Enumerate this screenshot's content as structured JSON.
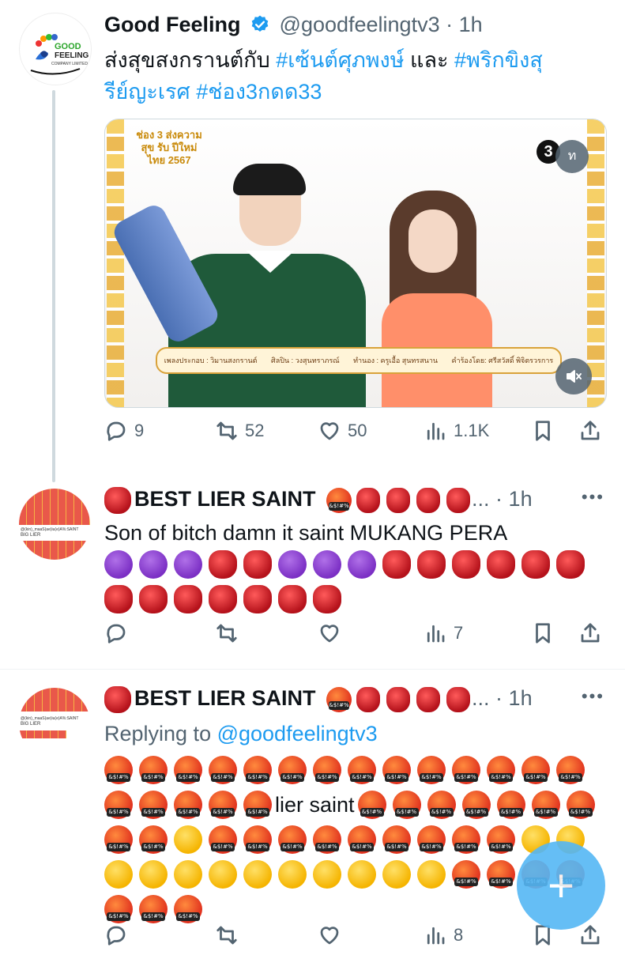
{
  "tweets": [
    {
      "name": "Good Feeling",
      "verified": true,
      "handle": "@goodfeelingtv3",
      "time": "1h",
      "avatar_logo": {
        "line1": "GOOD",
        "line2": "FEELING",
        "line3": "COMPANY LIMITED"
      },
      "text_plain_1": "ส่งสุขสงกรานต์กับ ",
      "hashtag_1": "#เซ้นต์ศุภพงษ์",
      "text_plain_2": " และ ",
      "hashtag_2": "#พริกขิงสุรีย์ญะเรศ",
      "hashtag_3": "#ช่อง3กดด33",
      "media": {
        "banner_top": "ช่อง 3 ส่งความสุข รับ ปีใหม่ไทย 2567",
        "channel_badge": "3",
        "rating_badge": "ท",
        "credits": [
          "เพลงประกอบ : วิมานสงกรานต์",
          "ศิลปิน : วงสุนทราภรณ์",
          "ทำนอง : ครูเอื้อ สุนทรสนาน",
          "คำร้องโดย: ศรีสวัสดิ์ พิจิตรวรการ"
        ]
      },
      "replies": "9",
      "reposts": "52",
      "likes": "50",
      "views": "1.1K"
    },
    {
      "name": "BEST LIER SAINT",
      "handle_truncated": "...",
      "time": "1h",
      "text": "Son of bitch damn it  saint MUKANG PERA",
      "views": "7",
      "avatar_text": {
        "line1": "@(kin)_maaS(ae)iu(e)A%:SAINT",
        "line2": "BIG LIER"
      }
    },
    {
      "name": "BEST LIER SAINT",
      "time": "1h",
      "replying_prefix": "Replying to ",
      "replying_handle": "@goodfeelingtv3",
      "inline_text": "lier saint",
      "views": "8",
      "avatar_text": {
        "line1": "@(kin)_maaS(ae)iu(e)A%:SAINT",
        "line2": "BIG LIER"
      }
    }
  ],
  "fab_label": "+",
  "colors": {
    "link": "#1d9bf0",
    "muted": "#536471",
    "fab": "#1d9bf0"
  }
}
